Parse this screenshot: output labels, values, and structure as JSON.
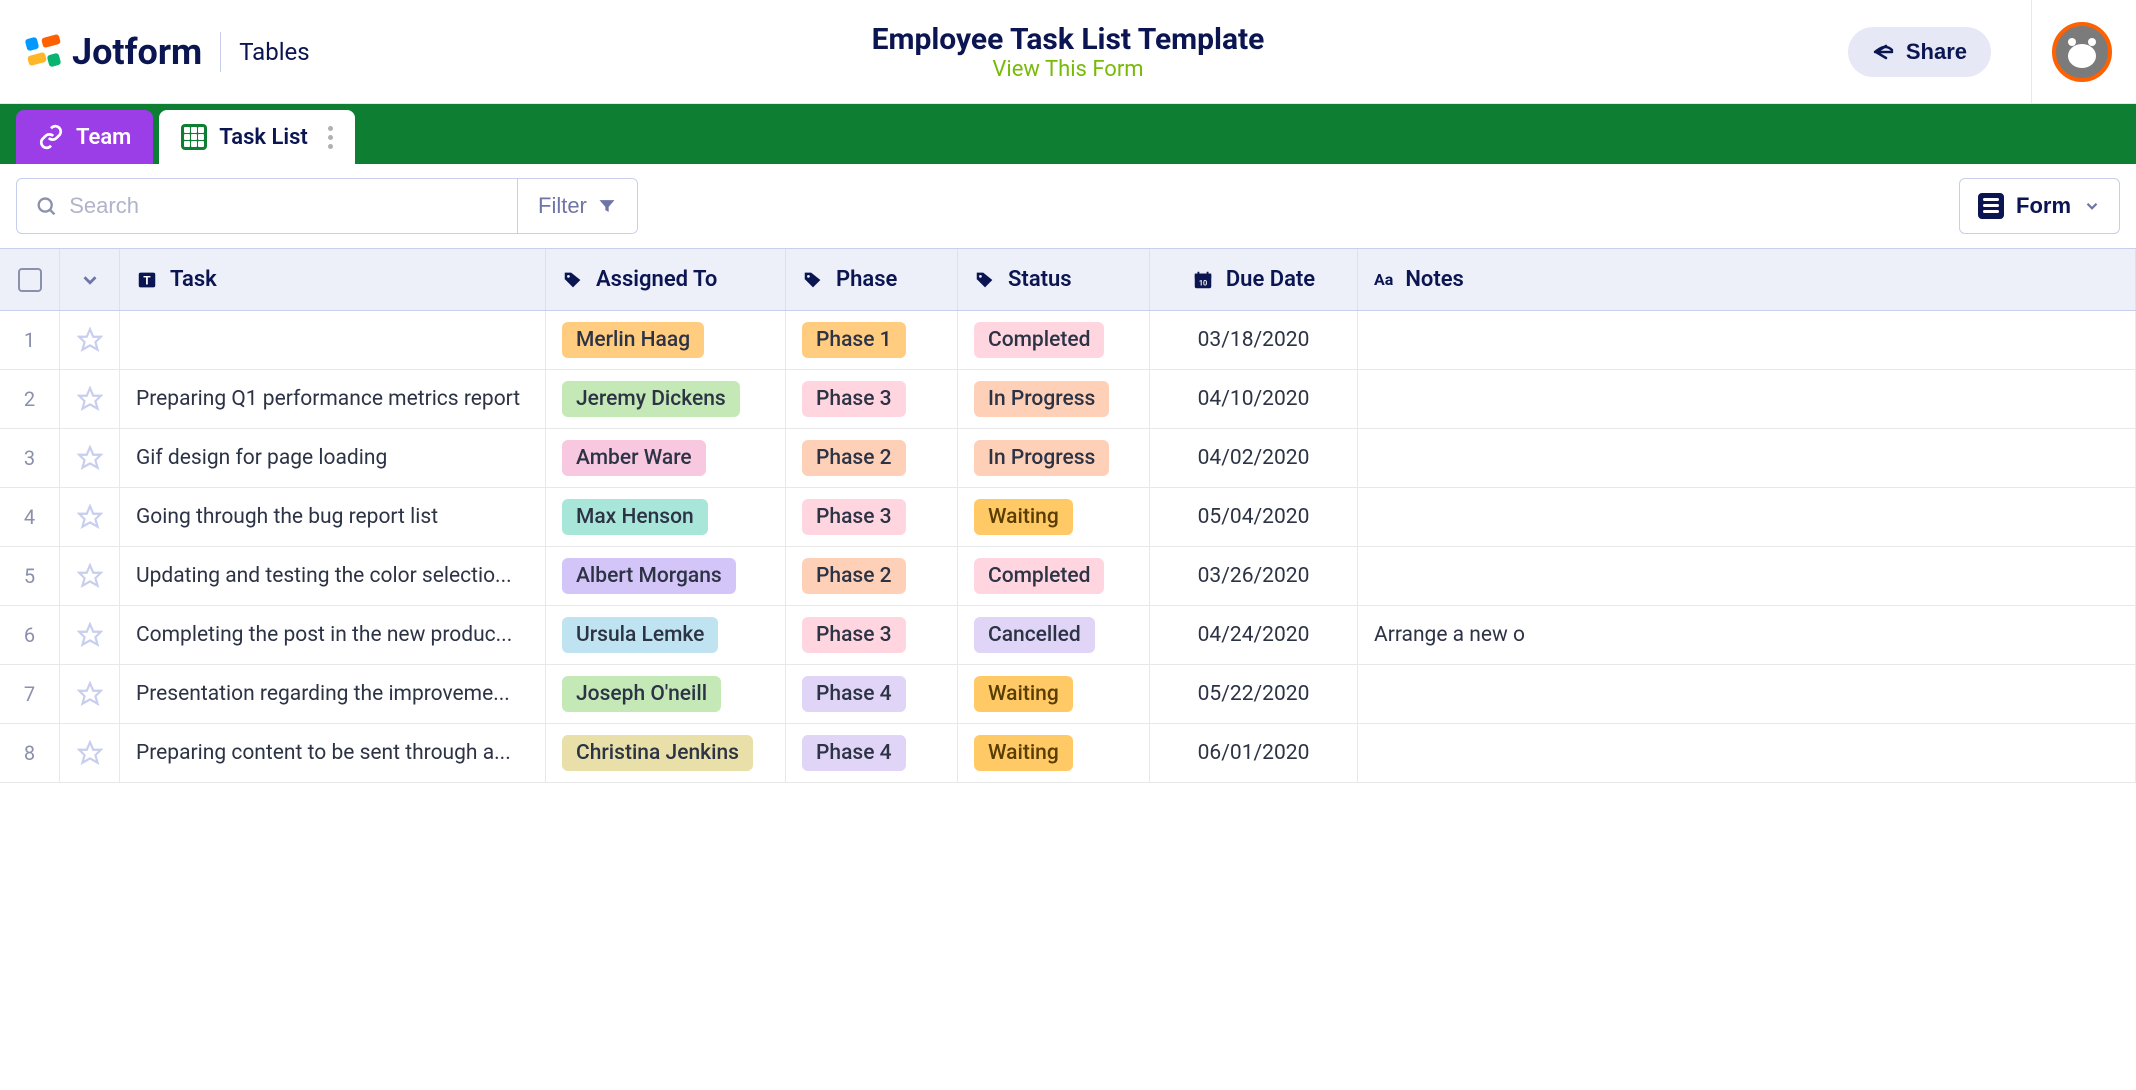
{
  "header": {
    "brand": "Jotform",
    "product": "Tables",
    "title": "Employee Task List Template",
    "subtitle": "View This Form",
    "share_label": "Share"
  },
  "tabs": {
    "team": "Team",
    "tasklist": "Task List"
  },
  "toolbar": {
    "search_placeholder": "Search",
    "filter_label": "Filter",
    "form_label": "Form"
  },
  "columns": {
    "task": "Task",
    "assigned_to": "Assigned To",
    "phase": "Phase",
    "status": "Status",
    "due_date": "Due Date",
    "notes": "Notes"
  },
  "rows": [
    {
      "num": "1",
      "task": "",
      "assigned": "Merlin Haag",
      "assigned_color": "p-orange",
      "phase": "Phase 1",
      "phase_color": "p-orange",
      "status": "Completed",
      "status_color": "p-lpink",
      "date": "03/18/2020",
      "notes": ""
    },
    {
      "num": "2",
      "task": "Preparing Q1 performance metrics report",
      "assigned": "Jeremy Dickens",
      "assigned_color": "p-green",
      "phase": "Phase 3",
      "phase_color": "p-lpink",
      "status": "In Progress",
      "status_color": "p-peach",
      "date": "04/10/2020",
      "notes": ""
    },
    {
      "num": "3",
      "task": "Gif design for page loading",
      "assigned": "Amber Ware",
      "assigned_color": "p-pink",
      "phase": "Phase 2",
      "phase_color": "p-peach",
      "status": "In Progress",
      "status_color": "p-peach",
      "date": "04/02/2020",
      "notes": ""
    },
    {
      "num": "4",
      "task": "Going through the bug report list",
      "assigned": "Max Henson",
      "assigned_color": "p-teal",
      "phase": "Phase 3",
      "phase_color": "p-lpink",
      "status": "Waiting",
      "status_color": "p-amber",
      "date": "05/04/2020",
      "notes": ""
    },
    {
      "num": "5",
      "task": "Updating and testing the color selectio...",
      "assigned": "Albert Morgans",
      "assigned_color": "p-purple",
      "phase": "Phase 2",
      "phase_color": "p-peach",
      "status": "Completed",
      "status_color": "p-lpink",
      "date": "03/26/2020",
      "notes": ""
    },
    {
      "num": "6",
      "task": "Completing the post in the new produc...",
      "assigned": "Ursula Lemke",
      "assigned_color": "p-blue",
      "phase": "Phase 3",
      "phase_color": "p-lpink",
      "status": "Cancelled",
      "status_color": "p-lpurple",
      "date": "04/24/2020",
      "notes": "Arrange a new o"
    },
    {
      "num": "7",
      "task": "Presentation regarding the improveme...",
      "assigned": "Joseph O'neill",
      "assigned_color": "p-green",
      "phase": "Phase 4",
      "phase_color": "p-lpurple",
      "status": "Waiting",
      "status_color": "p-amber",
      "date": "05/22/2020",
      "notes": ""
    },
    {
      "num": "8",
      "task": "Preparing content to be sent through a...",
      "assigned": "Christina Jenkins",
      "assigned_color": "p-yellow",
      "phase": "Phase 4",
      "phase_color": "p-lpurple",
      "status": "Waiting",
      "status_color": "p-amber",
      "date": "06/01/2020",
      "notes": ""
    }
  ]
}
